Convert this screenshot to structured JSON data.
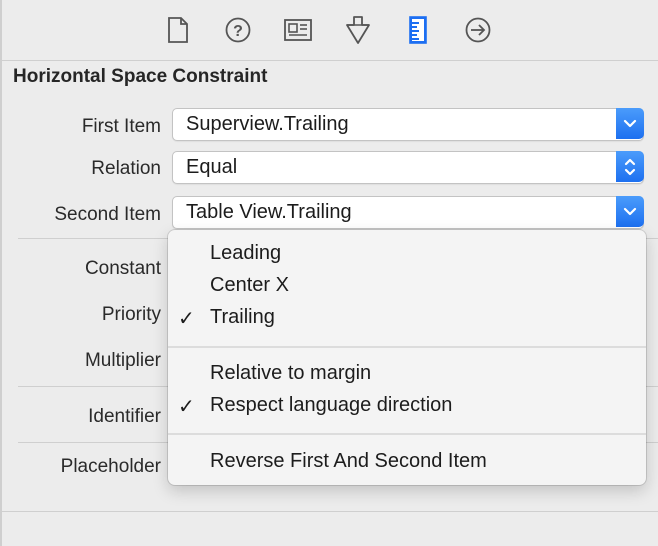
{
  "toolbar": {
    "icons": [
      "file-inspector-icon",
      "quick-help-icon",
      "identity-inspector-icon",
      "attributes-inspector-icon",
      "size-inspector-icon",
      "connections-inspector-icon"
    ],
    "accent": "#1d6ff2"
  },
  "section": {
    "title": "Horizontal Space Constraint"
  },
  "fields": {
    "first_item": {
      "label": "First Item",
      "value": "Superview.Trailing"
    },
    "relation": {
      "label": "Relation",
      "value": "Equal"
    },
    "second_item": {
      "label": "Second Item",
      "value": "Table View.Trailing"
    },
    "constant": {
      "label": "Constant"
    },
    "priority": {
      "label": "Priority"
    },
    "multiplier": {
      "label": "Multiplier"
    },
    "identifier": {
      "label": "Identifier"
    },
    "placeholder": {
      "label": "Placeholder"
    }
  },
  "menu": {
    "checkmark": "✓",
    "items": [
      {
        "label": "Leading",
        "checked": false
      },
      {
        "label": "Center X",
        "checked": false
      },
      {
        "label": "Trailing",
        "checked": true
      }
    ],
    "options": [
      {
        "label": "Relative to margin",
        "checked": false
      },
      {
        "label": "Respect language direction",
        "checked": true
      }
    ],
    "action": {
      "label": "Reverse First And Second Item"
    }
  }
}
